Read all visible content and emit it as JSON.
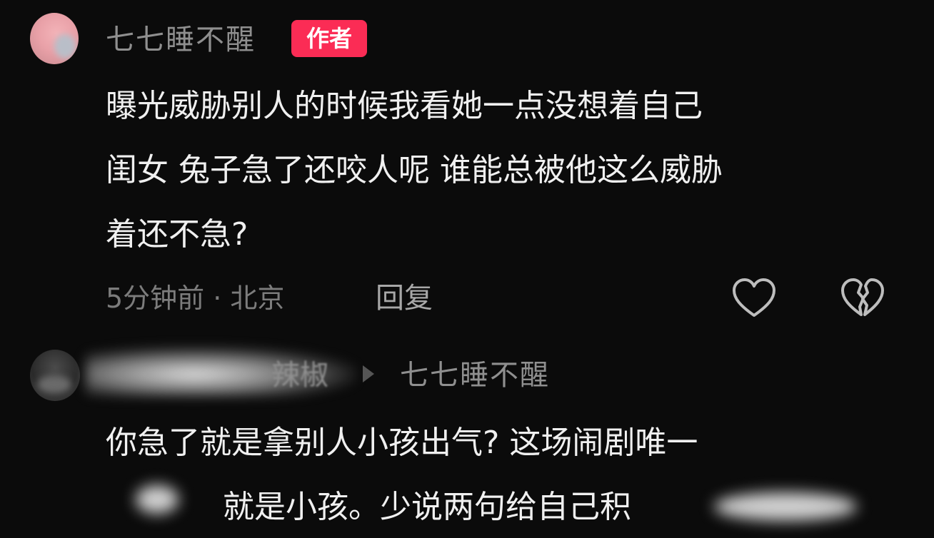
{
  "comment": {
    "username": "七七睡不醒",
    "badge": "作者",
    "lines": [
      "曝光威胁别人的时候我看她一点没想着自己",
      "闺女 兔子急了还咬人呢 谁能总被他这么威胁",
      "着还不急?"
    ],
    "meta": "5分钟前 · 北京",
    "reply_label": "回复",
    "like_icon": "heart-outline-icon",
    "dislike_icon": "broken-heart-icon"
  },
  "reply": {
    "username_partial": "辣椒",
    "reply_to": "七七睡不醒",
    "lines": [
      "你急了就是拿别人小孩出气? 这场闹剧唯一",
      "就是小孩。少说两句给自己积"
    ]
  }
}
